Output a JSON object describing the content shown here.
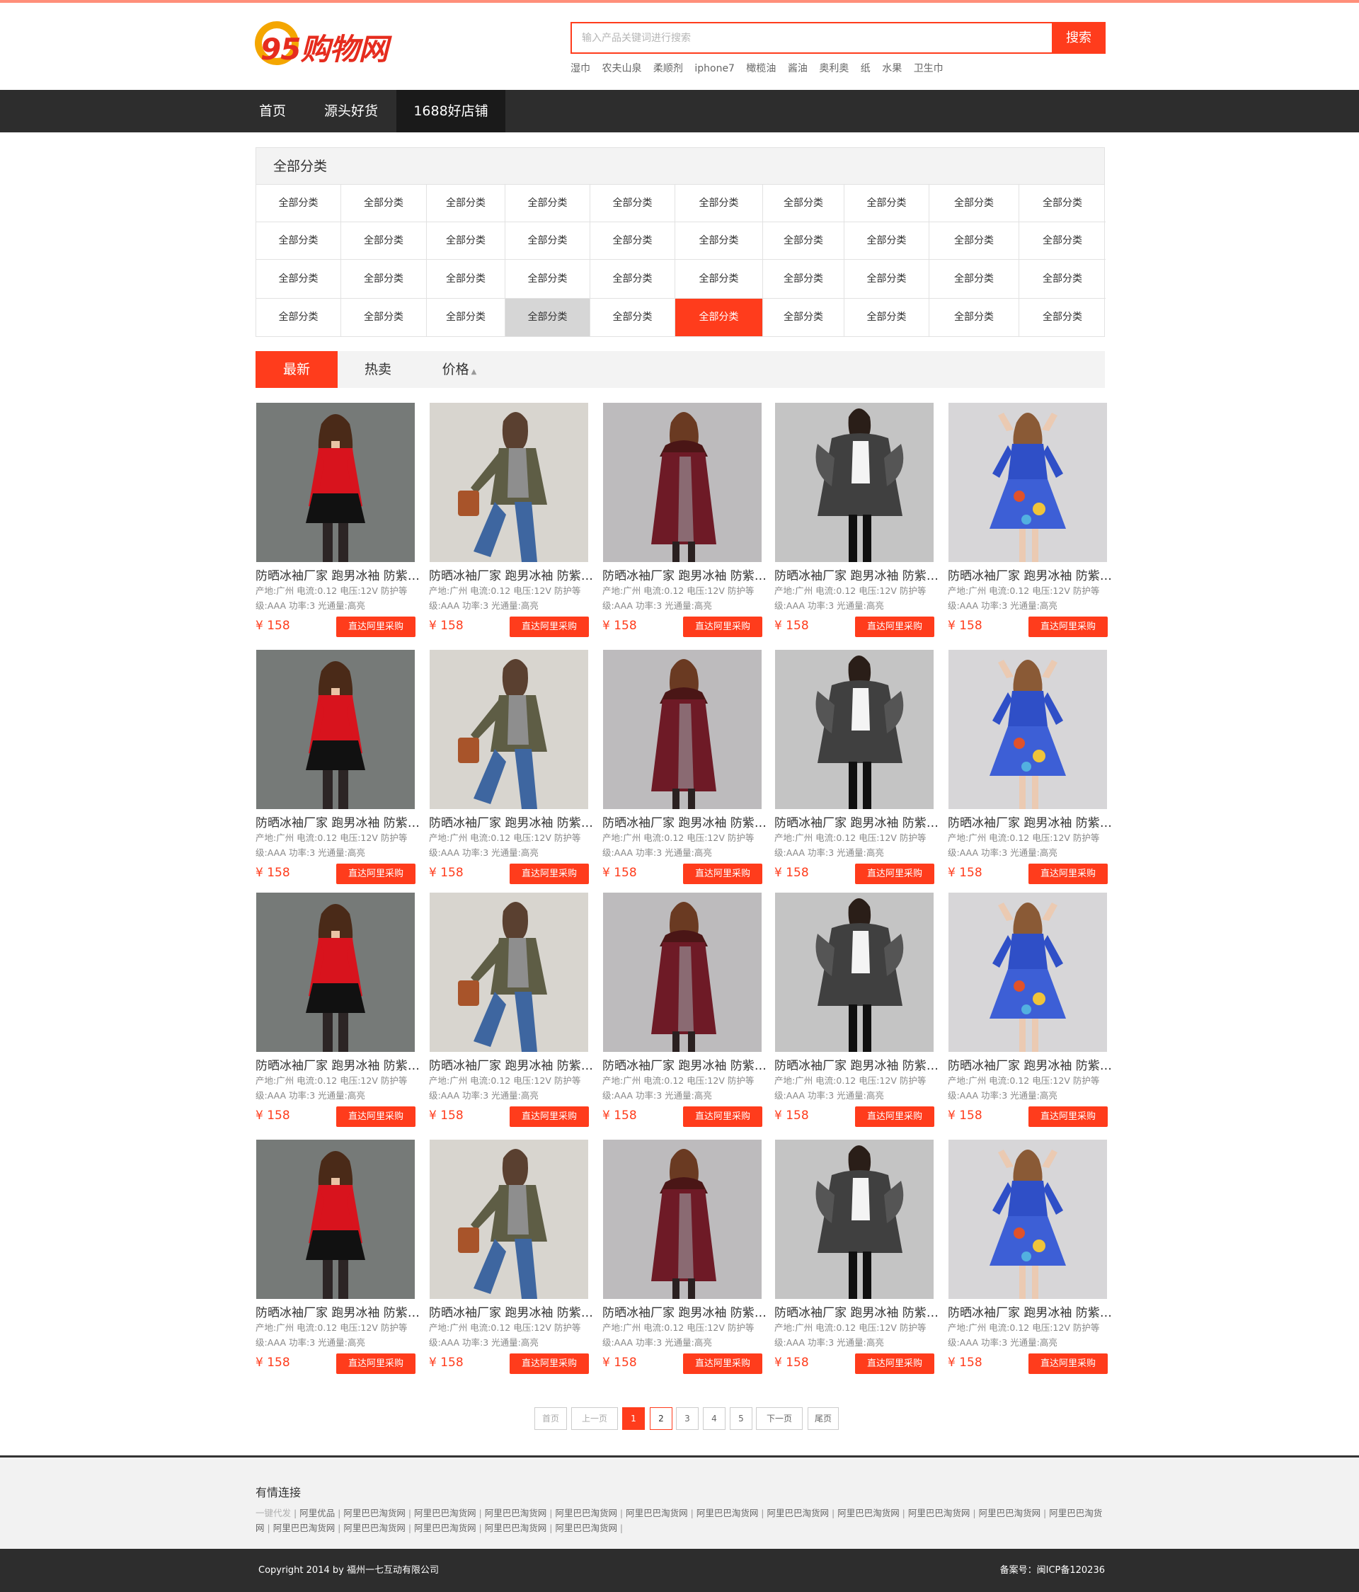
{
  "logo": {
    "text": "95购物网"
  },
  "search": {
    "placeholder": "输入产品关键词进行搜索",
    "button_label": "搜索"
  },
  "hot_words": [
    "湿巾",
    "农夫山泉",
    "柔顺剂",
    "iphone7",
    "橄榄油",
    "酱油",
    "奥利奥",
    "纸",
    "水果",
    "卫生巾"
  ],
  "nav": {
    "items": [
      "首页",
      "源头好货",
      "1688好店铺"
    ],
    "active_index": 2
  },
  "category": {
    "heading": "全部分类",
    "rows": [
      [
        "全部分类",
        "全部分类",
        "全部分类",
        "全部分类",
        "全部分类",
        "全部分类",
        "全部分类",
        "全部分类",
        "全部分类",
        "全部分类"
      ],
      [
        "全部分类",
        "全部分类",
        "全部分类",
        "全部分类",
        "全部分类",
        "全部分类",
        "全部分类",
        "全部分类",
        "全部分类",
        "全部分类"
      ],
      [
        "全部分类",
        "全部分类",
        "全部分类",
        "全部分类",
        "全部分类",
        "全部分类",
        "全部分类",
        "全部分类",
        "全部分类",
        "全部分类"
      ],
      [
        "全部分类",
        "全部分类",
        "全部分类",
        "全部分类",
        "全部分类",
        "全部分类",
        "全部分类",
        "全部分类",
        "全部分类",
        "全部分类"
      ]
    ]
  },
  "sort": {
    "items": [
      "最新",
      "热卖",
      "价格"
    ],
    "active_index": 0
  },
  "products": [
    {
      "title": "防晒冰袖厂家 跑男冰袖 防紫外线冰袖",
      "desc": "产地:广州 电流:0.12 电压:12V 防护等级:AAA 功率:3 光通量:高亮",
      "price": "¥ 158",
      "buy_label": "直达阿里采购",
      "image": "model-red-top"
    },
    {
      "title": "防晒冰袖厂家 跑男冰袖 防紫外线冰袖",
      "desc": "产地:广州 电流:0.12 电压:12V 防护等级:AAA 功率:3 光通量:高亮",
      "price": "¥ 158",
      "buy_label": "直达阿里采购",
      "image": "model-olive-jacket"
    },
    {
      "title": "防晒冰袖厂家 跑男冰袖 防紫外线冰袖",
      "desc": "产地:广州 电流:0.12 电压:12V 防护等级:AAA 功率:3 光通量:高亮",
      "price": "¥ 158",
      "buy_label": "直达阿里采购",
      "image": "model-burgundy-coat"
    },
    {
      "title": "防晒冰袖厂家 跑男冰袖 防紫外线冰袖",
      "desc": "产地:广州 电流:0.12 电压:12V 防护等级:AAA 功率:3 光通量:高亮",
      "price": "¥ 158",
      "buy_label": "直达阿里采购",
      "image": "model-black-coat"
    },
    {
      "title": "防晒冰袖厂家 跑男冰袖 防紫外线冰袖",
      "desc": "产地:广州 电流:0.12 电压:12V 防护等级:AAA 功率:3 光通量:高亮",
      "price": "¥ 158",
      "buy_label": "直达阿里采购",
      "image": "model-blue-dress"
    },
    {
      "title": "防晒冰袖厂家 跑男冰袖 防紫外线冰袖",
      "desc": "产地:广州 电流:0.12 电压:12V 防护等级:AAA 功率:3 光通量:高亮",
      "price": "¥ 158",
      "buy_label": "直达阿里采购",
      "image": "model-red-top"
    },
    {
      "title": "防晒冰袖厂家 跑男冰袖 防紫外线冰袖",
      "desc": "产地:广州 电流:0.12 电压:12V 防护等级:AAA 功率:3 光通量:高亮",
      "price": "¥ 158",
      "buy_label": "直达阿里采购",
      "image": "model-olive-jacket"
    },
    {
      "title": "防晒冰袖厂家 跑男冰袖 防紫外线冰袖",
      "desc": "产地:广州 电流:0.12 电压:12V 防护等级:AAA 功率:3 光通量:高亮",
      "price": "¥ 158",
      "buy_label": "直达阿里采购",
      "image": "model-burgundy-coat"
    },
    {
      "title": "防晒冰袖厂家 跑男冰袖 防紫外线冰袖",
      "desc": "产地:广州 电流:0.12 电压:12V 防护等级:AAA 功率:3 光通量:高亮",
      "price": "¥ 158",
      "buy_label": "直达阿里采购",
      "image": "model-black-coat"
    },
    {
      "title": "防晒冰袖厂家 跑男冰袖 防紫外线冰袖",
      "desc": "产地:广州 电流:0.12 电压:12V 防护等级:AAA 功率:3 光通量:高亮",
      "price": "¥ 158",
      "buy_label": "直达阿里采购",
      "image": "model-blue-dress"
    },
    {
      "title": "防晒冰袖厂家 跑男冰袖 防紫外线冰袖",
      "desc": "产地:广州 电流:0.12 电压:12V 防护等级:AAA 功率:3 光通量:高亮",
      "price": "¥ 158",
      "buy_label": "直达阿里采购",
      "image": "model-red-top"
    },
    {
      "title": "防晒冰袖厂家 跑男冰袖 防紫外线冰袖",
      "desc": "产地:广州 电流:0.12 电压:12V 防护等级:AAA 功率:3 光通量:高亮",
      "price": "¥ 158",
      "buy_label": "直达阿里采购",
      "image": "model-olive-jacket"
    },
    {
      "title": "防晒冰袖厂家 跑男冰袖 防紫外线冰袖",
      "desc": "产地:广州 电流:0.12 电压:12V 防护等级:AAA 功率:3 光通量:高亮",
      "price": "¥ 158",
      "buy_label": "直达阿里采购",
      "image": "model-burgundy-coat"
    },
    {
      "title": "防晒冰袖厂家 跑男冰袖 防紫外线冰袖",
      "desc": "产地:广州 电流:0.12 电压:12V 防护等级:AAA 功率:3 光通量:高亮",
      "price": "¥ 158",
      "buy_label": "直达阿里采购",
      "image": "model-black-coat"
    },
    {
      "title": "防晒冰袖厂家 跑男冰袖 防紫外线冰袖",
      "desc": "产地:广州 电流:0.12 电压:12V 防护等级:AAA 功率:3 光通量:高亮",
      "price": "¥ 158",
      "buy_label": "直达阿里采购",
      "image": "model-blue-dress"
    },
    {
      "title": "防晒冰袖厂家 跑男冰袖 防紫外线冰袖",
      "desc": "产地:广州 电流:0.12 电压:12V 防护等级:AAA 功率:3 光通量:高亮",
      "price": "¥ 158",
      "buy_label": "直达阿里采购",
      "image": "model-red-top"
    },
    {
      "title": "防晒冰袖厂家 跑男冰袖 防紫外线冰袖",
      "desc": "产地:广州 电流:0.12 电压:12V 防护等级:AAA 功率:3 光通量:高亮",
      "price": "¥ 158",
      "buy_label": "直达阿里采购",
      "image": "model-olive-jacket"
    },
    {
      "title": "防晒冰袖厂家 跑男冰袖 防紫外线冰袖",
      "desc": "产地:广州 电流:0.12 电压:12V 防护等级:AAA 功率:3 光通量:高亮",
      "price": "¥ 158",
      "buy_label": "直达阿里采购",
      "image": "model-burgundy-coat"
    },
    {
      "title": "防晒冰袖厂家 跑男冰袖 防紫外线冰袖",
      "desc": "产地:广州 电流:0.12 电压:12V 防护等级:AAA 功率:3 光通量:高亮",
      "price": "¥ 158",
      "buy_label": "直达阿里采购",
      "image": "model-black-coat"
    },
    {
      "title": "防晒冰袖厂家 跑男冰袖 防紫外线冰袖",
      "desc": "产地:广州 电流:0.12 电压:12V 防护等级:AAA 功率:3 光通量:高亮",
      "price": "¥ 158",
      "buy_label": "直达阿里采购",
      "image": "model-blue-dress"
    }
  ],
  "pagination": {
    "first": "首页",
    "prev": "上一页",
    "pages": [
      "1",
      "2",
      "3",
      "4",
      "5"
    ],
    "current": "1",
    "next": "下一页",
    "last": "尾页"
  },
  "footer_links": {
    "title": "有情连接",
    "links": [
      "一键代发",
      "阿里优品",
      "阿里巴巴淘货网",
      "阿里巴巴淘货网",
      "阿里巴巴淘货网",
      "阿里巴巴淘货网",
      "阿里巴巴淘货网",
      "阿里巴巴淘货网",
      "阿里巴巴淘货网",
      "阿里巴巴淘货网",
      "阿里巴巴淘货网",
      "阿里巴巴淘货网",
      "阿里巴巴淘货网",
      "阿里巴巴淘货网",
      "阿里巴巴淘货网",
      "阿里巴巴淘货网",
      "阿里巴巴淘货网",
      "阿里巴巴淘货网"
    ]
  },
  "bottom": {
    "copyright": "Copyright 2014 by 福州一七互动有限公司",
    "icp": "备案号：闽ICP备120236"
  },
  "colors": {
    "accent": "#ff3c1c",
    "nav_bg": "#2d2d2d",
    "panel_bg": "#f3f3f3"
  }
}
